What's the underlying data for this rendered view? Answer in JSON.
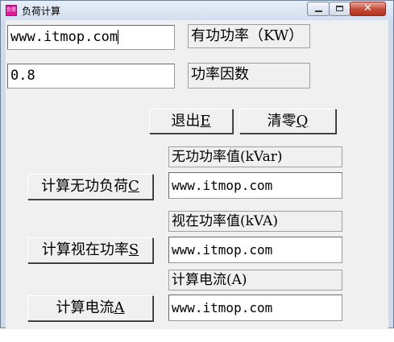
{
  "window": {
    "title": "负荷计算",
    "app_icon_text": "负荷"
  },
  "active_power": {
    "value": "www.itmop.com",
    "label": "有功功率（KW）"
  },
  "power_factor": {
    "value": "0.8",
    "label": "功率因数"
  },
  "buttons": {
    "exit": {
      "text": "退出",
      "key": "E"
    },
    "clear": {
      "text": "清零",
      "key": "Q"
    },
    "calc_reactive": {
      "text": "计算无功负荷",
      "key": "C"
    },
    "calc_apparent": {
      "text": "计算视在功率",
      "key": "S"
    },
    "calc_current": {
      "text": "计算电流",
      "key": "A"
    }
  },
  "reactive_power": {
    "label": "无功功率值(kVar)",
    "value": "www.itmop.com"
  },
  "apparent_power": {
    "label": "视在功率值(kVA)",
    "value": "www.itmop.com"
  },
  "current": {
    "label": "计算电流(A)",
    "value": "www.itmop.com"
  }
}
